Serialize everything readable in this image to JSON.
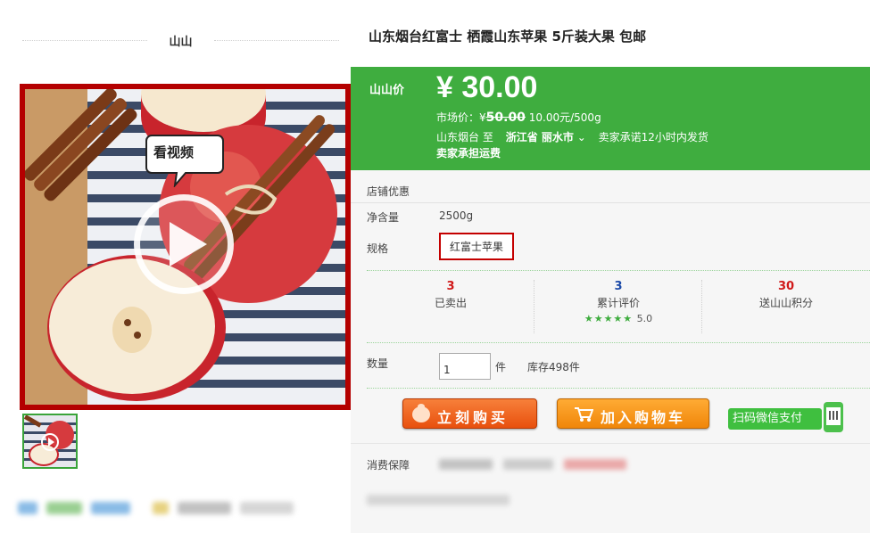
{
  "shop": {
    "name": "山山"
  },
  "product": {
    "title": "山东烟台红富士 栖霞山东苹果 5斤装大果 包邮"
  },
  "price": {
    "label": "山山价",
    "value": "¥ 30.00",
    "market_label": "市场价：¥",
    "market_value": "50.00",
    "unit_price": "10.00元/500g"
  },
  "shipping": {
    "from": "山东烟台",
    "to_label": "至",
    "destination": "浙江省 丽水市",
    "promise": "卖家承诺12小时内发货",
    "freight": "卖家承担运费"
  },
  "attributes": {
    "shop_promo_label": "店铺优惠",
    "net_label": "净含量",
    "net_value": "2500g",
    "spec_label": "规格",
    "spec_value": "红富士苹果"
  },
  "stats": [
    {
      "num": "3",
      "label": "已卖出",
      "color": "#d01919"
    },
    {
      "num": "3",
      "label": "累计评价",
      "color": "#1c4aa8",
      "stars": "★★★★★",
      "rating": "5.0"
    },
    {
      "num": "30",
      "label": "送山山积分",
      "color": "#d01919"
    }
  ],
  "purchase": {
    "qty_label": "数量",
    "qty_value": "1",
    "qty_unit": "件",
    "stock": "库存498件",
    "buy_label": "立刻购买",
    "cart_label": "加入购物车",
    "wechat_label": "扫码微信支付"
  },
  "guarantee": {
    "label": "消费保障"
  },
  "media": {
    "bubble_text": "看视频"
  },
  "colors": {
    "brand_green": "#3fad3f",
    "accent_red": "#b40000",
    "buy_orange": "#e8500e",
    "cart_orange": "#f0860a"
  }
}
